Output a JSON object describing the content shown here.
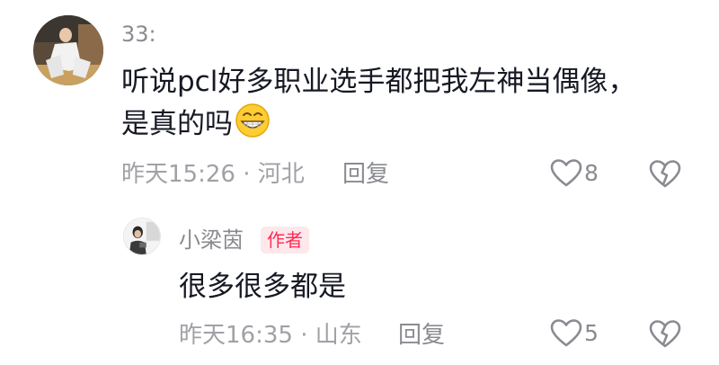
{
  "comment": {
    "username": "33:",
    "text": "听说pcl好多职业选手都把我左神当偶像，是真的吗",
    "emoji": "grinning-face-emoji",
    "time_location": "昨天15:26 · 河北",
    "reply_label": "回复",
    "like_count": "8",
    "icons": {
      "like": "heart-outline-icon",
      "dislike": "broken-heart-icon"
    }
  },
  "reply": {
    "username": "小梁茵",
    "badge": "作者",
    "text": "很多很多都是",
    "time_location": "昨天16:35 · 山东",
    "reply_label": "回复",
    "like_count": "5"
  },
  "colors": {
    "text_primary": "#161823",
    "text_secondary": "#8a8b91",
    "badge_bg": "#fde8ec",
    "badge_text": "#fe2c55"
  }
}
